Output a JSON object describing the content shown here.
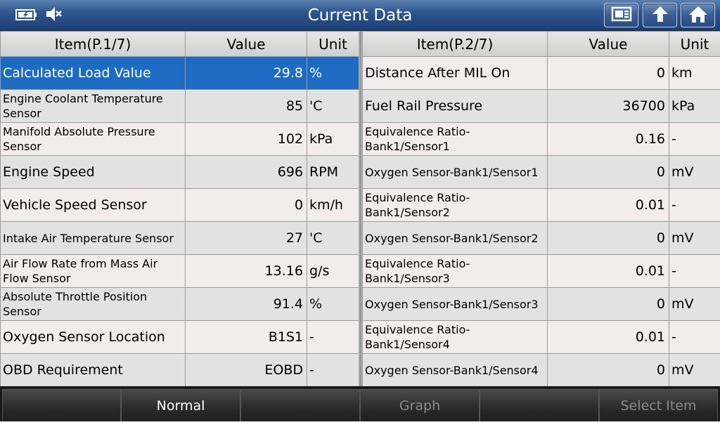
{
  "header": {
    "title": "Current Data",
    "icons": [
      "battery-icon",
      "mute-icon",
      "report-icon",
      "back-icon",
      "home-icon"
    ]
  },
  "left_table": {
    "columns": [
      "Item(P.1/7)",
      "Value",
      "Unit"
    ],
    "rows": [
      {
        "name": "Calculated Load Value",
        "value": "29.8",
        "unit": "%",
        "selected": true
      },
      {
        "name": "Engine Coolant Temperature Sensor",
        "value": "85",
        "unit": "'C"
      },
      {
        "name": "Manifold Absolute Pressure Sensor",
        "value": "102",
        "unit": "kPa"
      },
      {
        "name": "Engine Speed",
        "value": "696",
        "unit": "RPM"
      },
      {
        "name": "Vehicle Speed Sensor",
        "value": "0",
        "unit": "km/h"
      },
      {
        "name": "Intake Air Temperature Sensor",
        "value": "27",
        "unit": "'C"
      },
      {
        "name": "Air Flow Rate from Mass Air Flow Sensor",
        "value": "13.16",
        "unit": "g/s"
      },
      {
        "name": "Absolute Throttle Position Sensor",
        "value": "91.4",
        "unit": "%"
      },
      {
        "name": "Oxygen Sensor Location",
        "value": "B1S1",
        "unit": "-"
      },
      {
        "name": "OBD Requirement",
        "value": "EOBD",
        "unit": "-"
      }
    ]
  },
  "right_table": {
    "columns": [
      "Item(P.2/7)",
      "Value",
      "Unit"
    ],
    "rows": [
      {
        "name": "Distance After MIL On",
        "value": "0",
        "unit": "km"
      },
      {
        "name": "Fuel Rail Pressure",
        "value": "36700",
        "unit": "kPa"
      },
      {
        "name": "Equivalence Ratio-Bank1/Sensor1",
        "value": "0.16",
        "unit": "-"
      },
      {
        "name": "Oxygen Sensor-Bank1/Sensor1",
        "value": "0",
        "unit": "mV"
      },
      {
        "name": "Equivalence Ratio-Bank1/Sensor2",
        "value": "0.01",
        "unit": "-"
      },
      {
        "name": "Oxygen Sensor-Bank1/Sensor2",
        "value": "0",
        "unit": "mV"
      },
      {
        "name": "Equivalence Ratio-Bank1/Sensor3",
        "value": "0.01",
        "unit": "-"
      },
      {
        "name": "Oxygen Sensor-Bank1/Sensor3",
        "value": "0",
        "unit": "mV"
      },
      {
        "name": "Equivalence Ratio-Bank1/Sensor4",
        "value": "0.01",
        "unit": "-"
      },
      {
        "name": "Oxygen Sensor-Bank1/Sensor4",
        "value": "0",
        "unit": "mV"
      }
    ]
  },
  "footer": {
    "buttons": [
      {
        "label": "",
        "enabled": true
      },
      {
        "label": "Normal",
        "enabled": true
      },
      {
        "label": "",
        "enabled": true
      },
      {
        "label": "Graph",
        "enabled": false
      },
      {
        "label": "",
        "enabled": true
      },
      {
        "label": "Select Item",
        "enabled": false
      }
    ]
  },
  "colors": {
    "header_blue": "#2f568f",
    "selected_row": "#1d6bc3",
    "row_odd": "#f3ecec",
    "row_even": "#e3e2e2"
  }
}
